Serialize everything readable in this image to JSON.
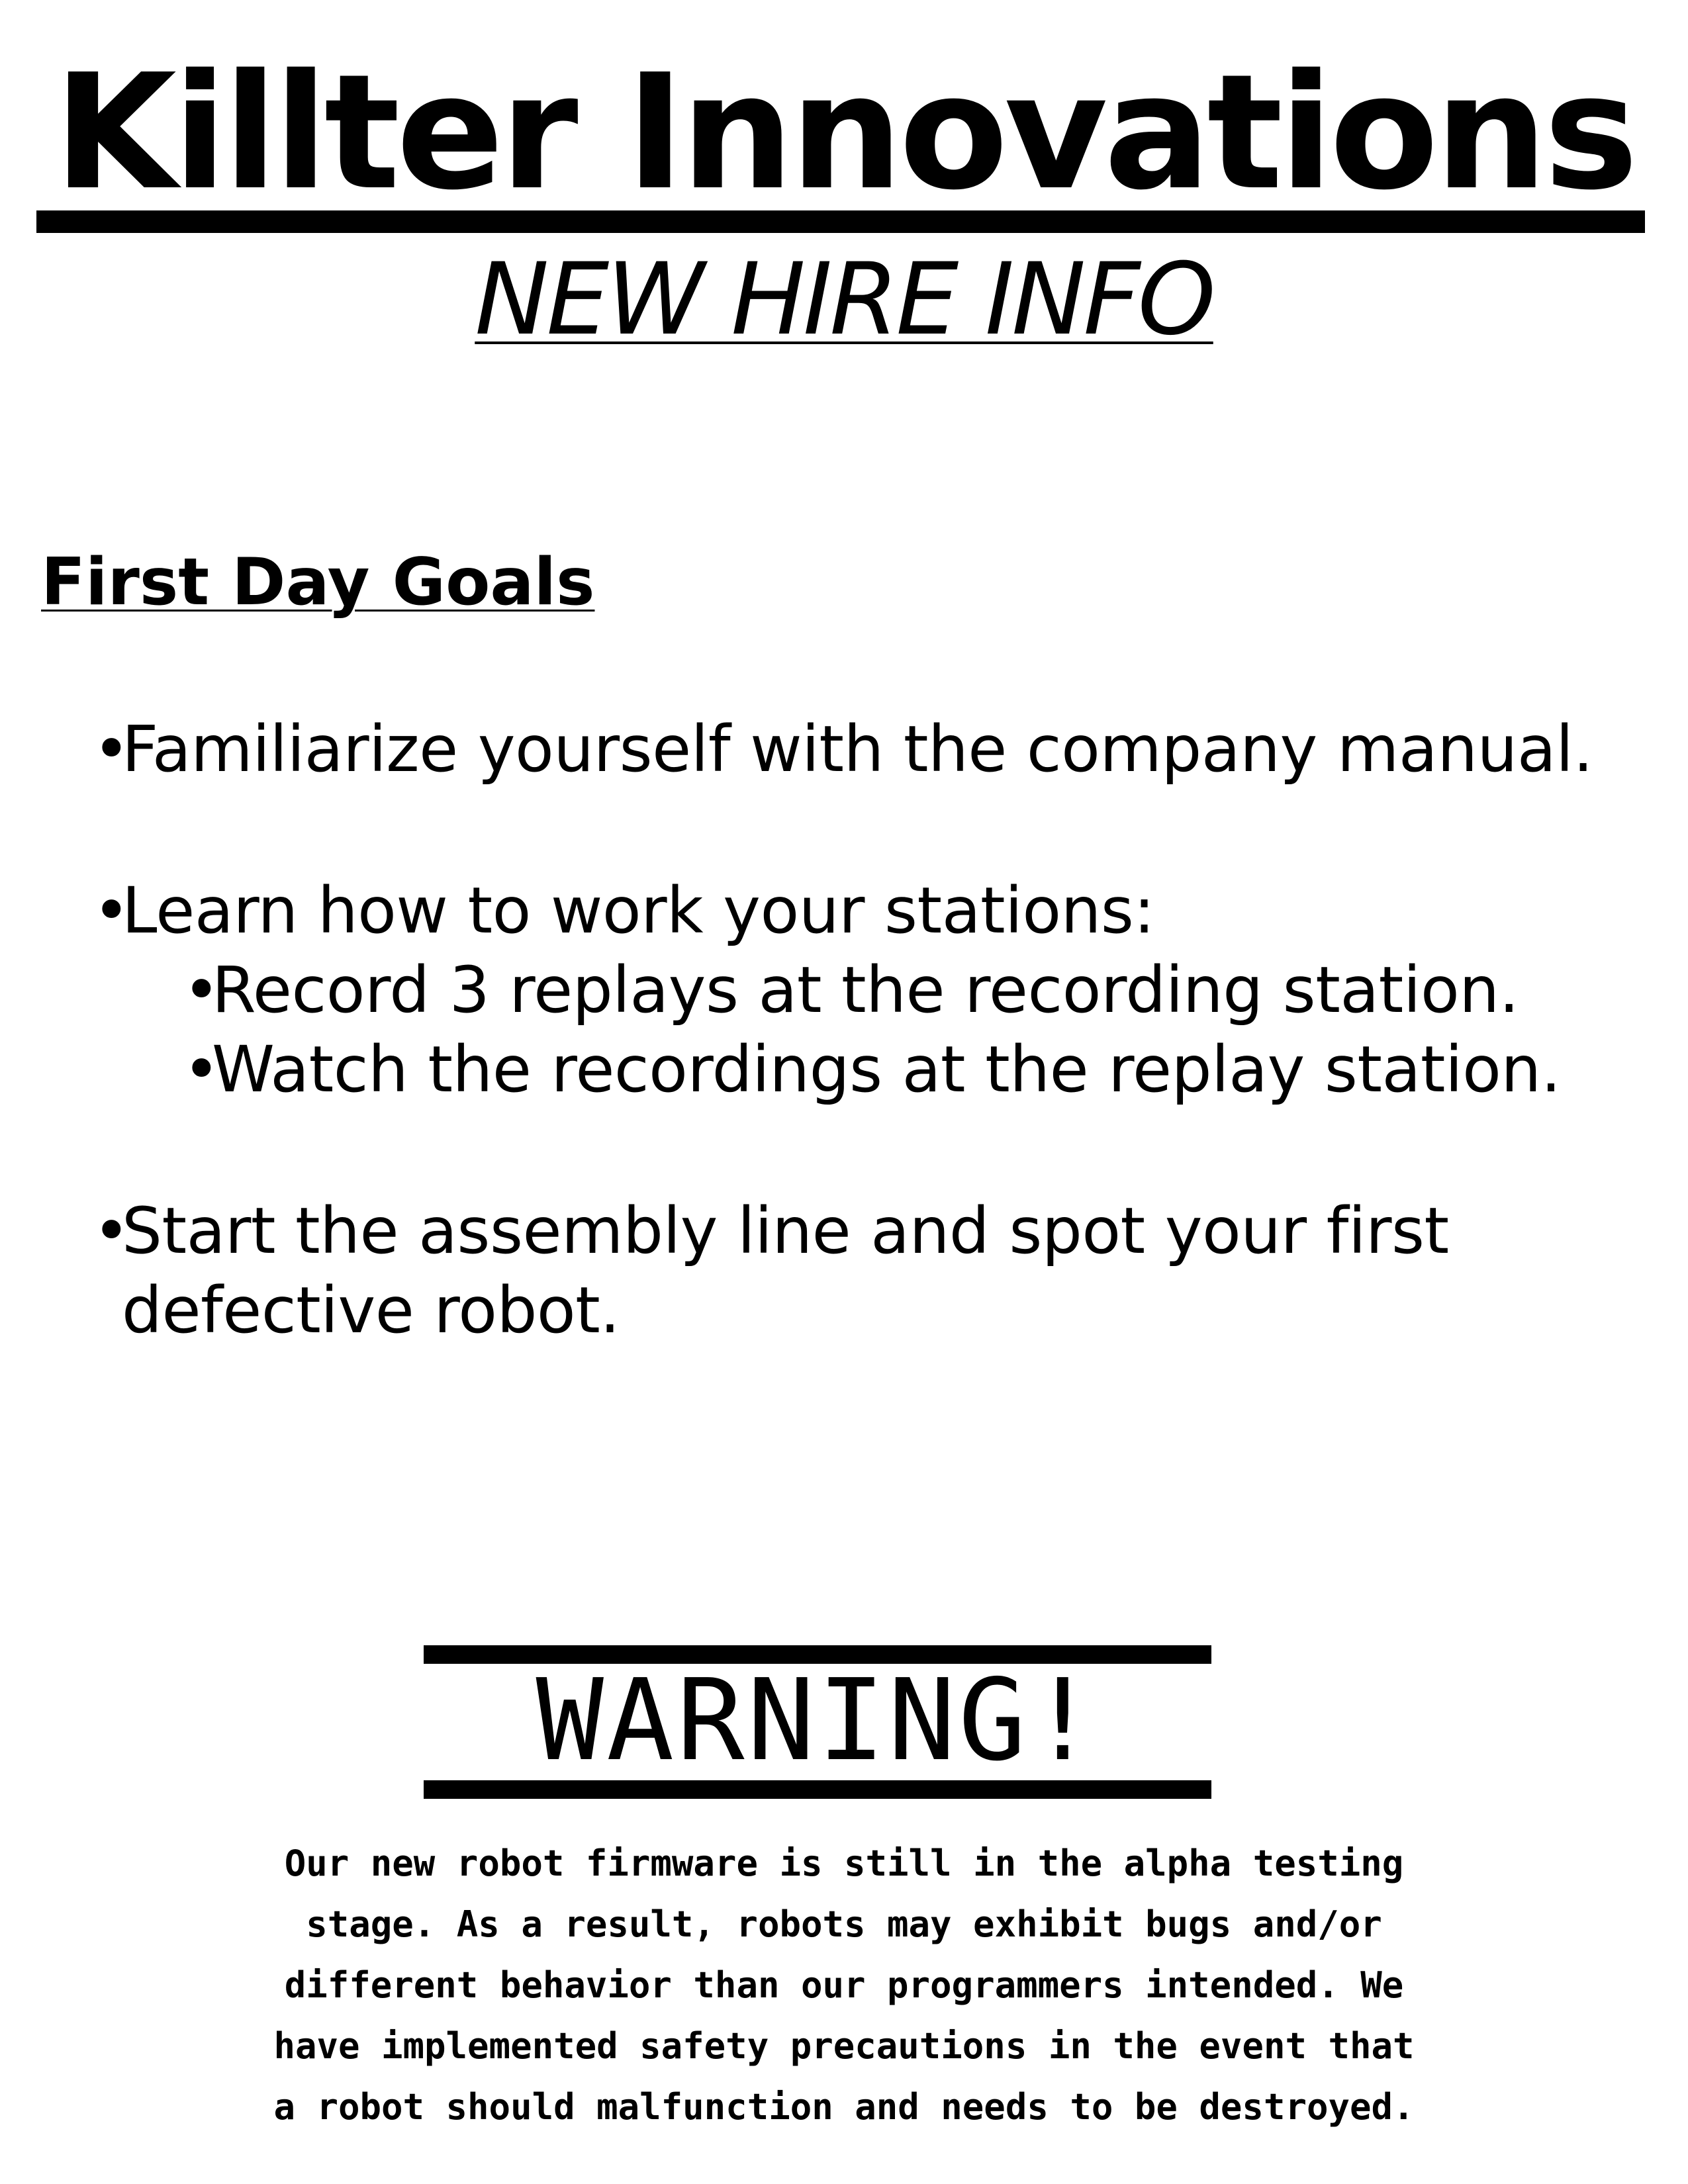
{
  "header": {
    "company": "Killter Innovations",
    "subtitle": "NEW HIRE INFO"
  },
  "goals": {
    "heading": "First Day Goals",
    "bullet": "•",
    "item1": "Familiarize yourself with the company manual.",
    "item2": "Learn how to work your stations:",
    "item2_sub1": "Record 3 replays at the recording station.",
    "item2_sub2": "Watch the recordings at the replay station.",
    "item3_line1": "Start the assembly line and spot your first",
    "item3_line2": "defective robot."
  },
  "warning": {
    "title": "WARNING!",
    "lines": [
      "Our new robot firmware is still in the alpha testing",
      "stage. As a result, robots may exhibit bugs and/or",
      "different behavior than our programmers intended. We",
      "have implemented safety precautions in the event that",
      "a robot should malfunction and needs to be destroyed."
    ]
  }
}
